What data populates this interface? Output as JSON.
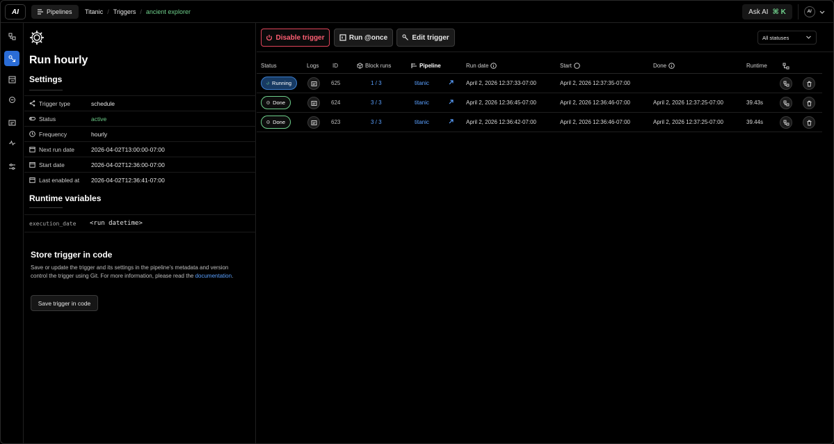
{
  "topbar": {
    "logo": "AI",
    "pipelines_label": "Pipelines",
    "crumbs": [
      "Titanic",
      "Triggers",
      "ancient explorer"
    ],
    "ask_ai_label": "Ask AI",
    "ask_ai_shortcut": "⌘ K",
    "user_logo": "AI"
  },
  "trigger": {
    "title": "Run hourly",
    "settings_heading": "Settings",
    "settings": [
      {
        "label": "Trigger type",
        "value": "schedule",
        "icon": "share-icon"
      },
      {
        "label": "Status",
        "value": "active",
        "icon": "toggle-icon"
      },
      {
        "label": "Frequency",
        "value": "hourly",
        "icon": "clock-icon"
      },
      {
        "label": "Next run date",
        "value": "2026-04-02T13:00:00-07:00",
        "icon": "calendar-icon"
      },
      {
        "label": "Start date",
        "value": "2026-04-02T12:36:00-07:00",
        "icon": "calendar-icon"
      },
      {
        "label": "Last enabled at",
        "value": "2026-04-02T12:36:41-07:00",
        "icon": "calendar-icon"
      }
    ],
    "runtime_heading": "Runtime variables",
    "runtime_var_key": "execution_date",
    "runtime_var_value": "<run datetime>",
    "store_heading": "Store trigger in code",
    "store_text": "Save or update the trigger and its settings in the pipeline's metadata and version control the trigger using Git. For more information, please read the",
    "store_link": "documentation",
    "store_text_end": ".",
    "store_button": "Save trigger in code"
  },
  "toolbar": {
    "disable_label": "Disable trigger",
    "run_once_label": "Run @once",
    "edit_label": "Edit trigger",
    "status_filter": "All statuses"
  },
  "table": {
    "headers": {
      "status": "Status",
      "logs": "Logs",
      "id": "ID",
      "block_runs": "Block runs",
      "pipeline": "Pipeline",
      "run_date": "Run date",
      "start": "Start",
      "done": "Done",
      "runtime": "Runtime"
    },
    "rows": [
      {
        "status": "Running",
        "id": "625",
        "block_runs": "1 / 3",
        "pipeline": "titanic",
        "run_date": "April 2, 2026 12:37:33-07:00",
        "start": "April 2, 2026 12:37:35-07:00",
        "done": "",
        "runtime": ""
      },
      {
        "status": "Done",
        "id": "624",
        "block_runs": "3 / 3",
        "pipeline": "titanic",
        "run_date": "April 2, 2026 12:36:45-07:00",
        "start": "April 2, 2026 12:36:46-07:00",
        "done": "April 2, 2026 12:37:25-07:00",
        "runtime": "39.43s"
      },
      {
        "status": "Done",
        "id": "623",
        "block_runs": "3 / 3",
        "pipeline": "titanic",
        "run_date": "April 2, 2026 12:36:42-07:00",
        "start": "April 2, 2026 12:36:46-07:00",
        "done": "April 2, 2026 12:37:25-07:00",
        "runtime": "39.44s"
      }
    ]
  },
  "colors": {
    "accent_blue": "#2a6cd6",
    "success_green": "#6fd08c",
    "danger_red": "#e0455a",
    "link_blue": "#5aa0ff"
  }
}
